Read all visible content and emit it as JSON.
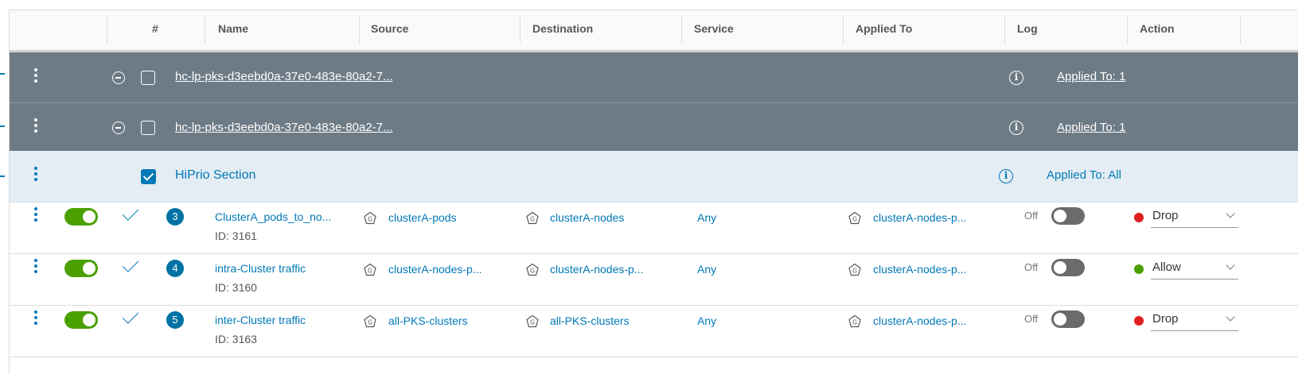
{
  "header": {
    "cols": {
      "number": "#",
      "name": "Name",
      "source": "Source",
      "destination": "Destination",
      "service": "Service",
      "applied_to": "Applied To",
      "log": "Log",
      "action": "Action"
    }
  },
  "policies": [
    {
      "name": "hc-lp-pks-d3eebd0a-37e0-483e-80a2-7...",
      "applied": "Applied To: 1"
    },
    {
      "name": "hc-lp-pks-d3eebd0a-37e0-483e-80a2-7...",
      "applied": "Applied To: 1"
    }
  ],
  "section": {
    "title": "HiPrio Section",
    "applied": "Applied To: All",
    "checked": true
  },
  "rules": [
    {
      "number": "3",
      "name": "ClusterA_pods_to_no...",
      "id": "ID: 3161",
      "source": "clusterA-pods",
      "destination": "clusterA-nodes",
      "service": "Any",
      "applied_to": "clusterA-nodes-p...",
      "log": "Off",
      "action": "Drop",
      "action_color": "#e02020",
      "enabled": true
    },
    {
      "number": "4",
      "name": "intra-Cluster traffic",
      "id": "ID: 3160",
      "source": "clusterA-nodes-p...",
      "destination": "clusterA-nodes-p...",
      "service": "Any",
      "applied_to": "clusterA-nodes-p...",
      "log": "Off",
      "action": "Allow",
      "action_color": "#4aa000",
      "enabled": true
    },
    {
      "number": "5",
      "name": "inter-Cluster traffic",
      "id": "ID: 3163",
      "source": "all-PKS-clusters",
      "destination": "all-PKS-clusters",
      "service": "Any",
      "applied_to": "clusterA-nodes-p...",
      "log": "Off",
      "action": "Drop",
      "action_color": "#e02020",
      "enabled": true
    }
  ],
  "icons": {
    "kebab": "vertical-ellipsis-icon",
    "group": "group-icon",
    "info": "info-circle-icon",
    "collapse": "minus-circle-icon",
    "check": "check-icon",
    "chevron": "chevron-down-icon"
  },
  "colors": {
    "accent": "#0079b8",
    "policy_bg": "#6d7b86",
    "section_bg": "#e4edf3",
    "toggle_on": "#4aa000",
    "toggle_off": "#6b6b6b"
  }
}
